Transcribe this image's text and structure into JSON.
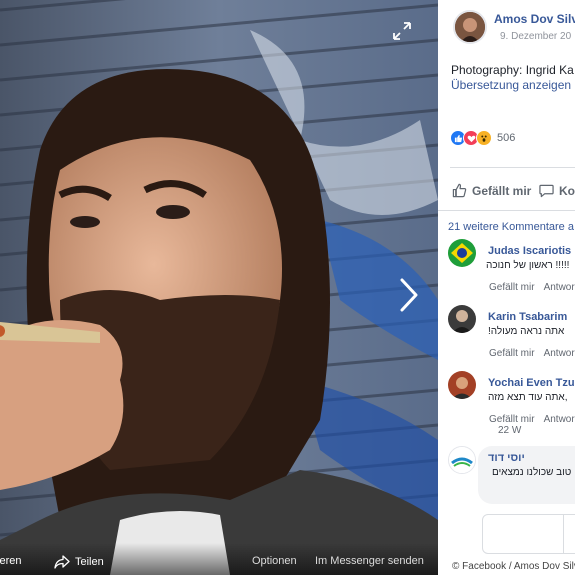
{
  "viewer": {
    "bottom_bar": {
      "left_cut_label": "tieren",
      "share_label": "Teilen",
      "options_label": "Optionen",
      "messenger_label": "Im Messenger senden"
    }
  },
  "post": {
    "author": "Amos Dov Silv",
    "date": "9. Dezember 20",
    "caption": "Photography: Ingrid Ka",
    "translate_label": "Übersetzung anzeigen",
    "reaction_count": "506",
    "like_label": "Gefällt mir",
    "comment_label": "Ko",
    "more_comments_label": "21 weitere Kommentare a"
  },
  "comments": [
    {
      "name": "Judas Iscariotis",
      "text": "ראשון של חנוכה !!!!!",
      "actions": [
        "Gefällt mir",
        "Antwor"
      ],
      "time": ""
    },
    {
      "name": "Karin Tsabarim",
      "text": "!אתה נראה מעולה",
      "actions": [
        "Gefällt mir",
        "Antwor"
      ],
      "time": ""
    },
    {
      "name": "Yochai Even Tzu",
      "text": "אתה עוד תצא מזה,",
      "actions": [
        "Gefällt mir",
        "Antwor"
      ],
      "time": "22 W"
    },
    {
      "name": "יוסי דוד",
      "text": "טוב שכולנו נמצאים",
      "actions": [],
      "time": ""
    }
  ],
  "watermark": "© Facebook / Amos Dov Silver",
  "colors": {
    "link": "#385898",
    "like": "#2078f4",
    "love": "#f33e58",
    "wow": "#f7b125"
  }
}
